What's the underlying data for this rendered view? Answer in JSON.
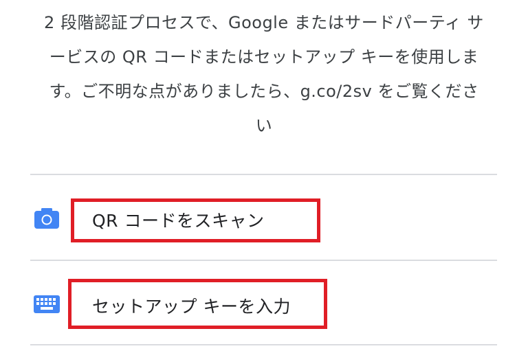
{
  "description": {
    "lines": [
      "2 段階認証プロセスで、Google またはサードパーティ サ",
      "ービスの QR コードまたはセットアップ キーを使用しま",
      "す。ご不明な点がありましたら、g.co/2sv をご覧くださ",
      "い"
    ]
  },
  "options": {
    "scan_qr": {
      "label": "QR コードをスキャン",
      "icon": "camera-icon"
    },
    "enter_key": {
      "label": "セットアップ キーを入力",
      "icon": "keyboard-icon"
    }
  },
  "colors": {
    "accent_blue": "#4285f4",
    "highlight_red": "#e01e26",
    "divider": "#dadce0",
    "text": "#202124"
  }
}
